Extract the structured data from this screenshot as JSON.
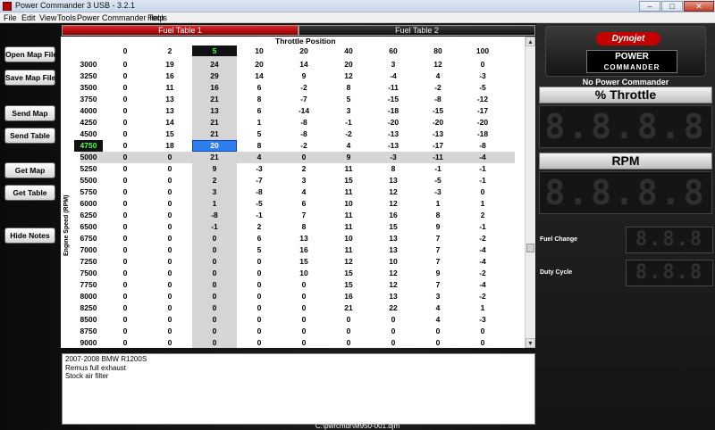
{
  "window": {
    "title": "Power Commander 3 USB - 3.2.1",
    "minimize": "–",
    "maximize": "□",
    "close": "✕"
  },
  "menu": [
    "File",
    "Edit",
    "View",
    "Tools",
    "Power Commander Tools",
    "Help"
  ],
  "sidebar": {
    "open_map": "Open Map File",
    "save_map": "Save Map File",
    "send_map": "Send Map",
    "send_table": "Send Table",
    "get_map": "Get Map",
    "get_table": "Get Table",
    "hide_notes": "Hide Notes"
  },
  "tabs": {
    "fuel1": "Fuel Table 1",
    "fuel2": "Fuel Table 2"
  },
  "table": {
    "x_title": "Throttle Position",
    "y_title": "Engine Speed (RPM)",
    "columns": [
      "0",
      "2",
      "5",
      "10",
      "20",
      "40",
      "60",
      "80",
      "100"
    ],
    "selected_col": 2,
    "selected_row": 6,
    "rpm": [
      "3000",
      "3250",
      "3500",
      "3750",
      "4000",
      "4250",
      "4500",
      "4750",
      "5000",
      "5250",
      "5500",
      "5750",
      "6000",
      "6250",
      "6500",
      "6750",
      "7000",
      "7250",
      "7500",
      "7750",
      "8000",
      "8250",
      "8500",
      "8750",
      "9000"
    ],
    "rows": [
      [
        "0",
        "19",
        "24",
        "20",
        "14",
        "20",
        "3",
        "12",
        "0"
      ],
      [
        "0",
        "16",
        "29",
        "14",
        "9",
        "12",
        "-4",
        "4",
        "-3"
      ],
      [
        "0",
        "11",
        "16",
        "6",
        "-2",
        "8",
        "-11",
        "-2",
        "-5"
      ],
      [
        "0",
        "13",
        "21",
        "8",
        "-7",
        "5",
        "-15",
        "-8",
        "-12"
      ],
      [
        "0",
        "13",
        "13",
        "6",
        "-14",
        "3",
        "-18",
        "-15",
        "-17"
      ],
      [
        "0",
        "14",
        "21",
        "1",
        "-8",
        "-1",
        "-20",
        "-20",
        "-20"
      ],
      [
        "0",
        "15",
        "21",
        "5",
        "-8",
        "-2",
        "-13",
        "-13",
        "-18"
      ],
      [
        "0",
        "18",
        "20",
        "8",
        "-2",
        "4",
        "-13",
        "-17",
        "-8"
      ],
      [
        "0",
        "0",
        "21",
        "4",
        "0",
        "9",
        "-3",
        "-11",
        "-4"
      ],
      [
        "0",
        "0",
        "9",
        "-3",
        "2",
        "11",
        "8",
        "-1",
        "-1"
      ],
      [
        "0",
        "0",
        "2",
        "-7",
        "3",
        "15",
        "13",
        "-5",
        "-1"
      ],
      [
        "0",
        "0",
        "3",
        "-8",
        "4",
        "11",
        "12",
        "-3",
        "0"
      ],
      [
        "0",
        "0",
        "1",
        "-5",
        "6",
        "10",
        "12",
        "1",
        "1"
      ],
      [
        "0",
        "0",
        "-8",
        "-1",
        "7",
        "11",
        "16",
        "8",
        "2"
      ],
      [
        "0",
        "0",
        "-1",
        "2",
        "8",
        "11",
        "15",
        "9",
        "-1"
      ],
      [
        "0",
        "0",
        "0",
        "6",
        "13",
        "10",
        "13",
        "7",
        "-2"
      ],
      [
        "0",
        "0",
        "0",
        "5",
        "16",
        "11",
        "13",
        "7",
        "-4"
      ],
      [
        "0",
        "0",
        "0",
        "0",
        "15",
        "12",
        "10",
        "7",
        "-4"
      ],
      [
        "0",
        "0",
        "0",
        "0",
        "10",
        "15",
        "12",
        "9",
        "-2"
      ],
      [
        "0",
        "0",
        "0",
        "0",
        "0",
        "15",
        "12",
        "7",
        "-4"
      ],
      [
        "0",
        "0",
        "0",
        "0",
        "0",
        "16",
        "13",
        "3",
        "-2"
      ],
      [
        "0",
        "0",
        "0",
        "0",
        "0",
        "21",
        "22",
        "4",
        "1"
      ],
      [
        "0",
        "0",
        "0",
        "0",
        "0",
        "0",
        "0",
        "4",
        "-3"
      ],
      [
        "0",
        "0",
        "0",
        "0",
        "0",
        "0",
        "0",
        "0",
        "0"
      ],
      [
        "0",
        "0",
        "0",
        "0",
        "0",
        "0",
        "0",
        "0",
        "0"
      ]
    ]
  },
  "notes": [
    "2007-2008 BMW R1200S",
    "Remus full exhaust",
    "Stock air filter"
  ],
  "status": {
    "file_path": "C:\\pwrcmdr\\M950-001.djm"
  },
  "right_panel": {
    "brand": "Dynojet",
    "product_line1": "POWER",
    "product_line2": "COMMANDER",
    "status_text": "No Power Commander",
    "throttle_label": "% Throttle",
    "rpm_label": "RPM",
    "fuel_change_label": "Fuel Change",
    "duty_cycle_label": "Duty Cycle",
    "digit_placeholder": "8.8.8.8",
    "mini_digit_placeholder": "8.8.8"
  },
  "colors": {
    "active_tab": "#e12626",
    "selection_blue": "#2f7ef0",
    "selection_header_text": "#4dff4d"
  }
}
